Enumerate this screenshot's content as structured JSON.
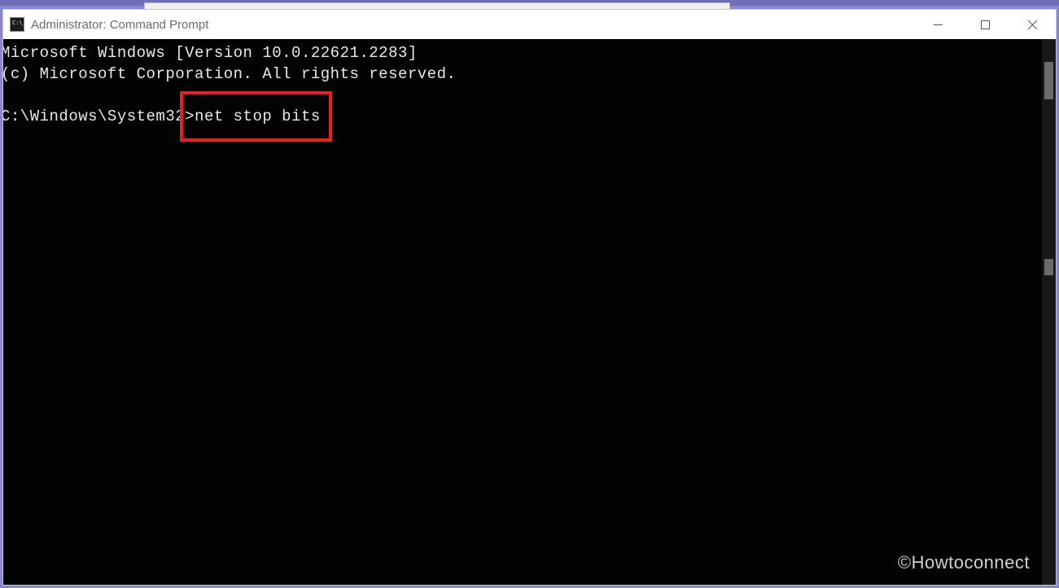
{
  "window": {
    "title": "Administrator: Command Prompt"
  },
  "terminal": {
    "line1": "Microsoft Windows [Version 10.0.22621.2283]",
    "line2": "(c) Microsoft Corporation. All rights reserved.",
    "prompt": "C:\\Windows\\System32>",
    "command": "net stop bits"
  },
  "watermark": "©Howtoconnect"
}
